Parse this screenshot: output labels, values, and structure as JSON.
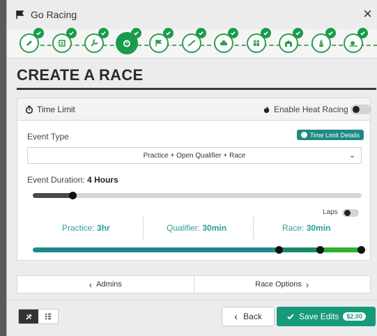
{
  "window": {
    "title": "Go Racing",
    "close_glyph": "×"
  },
  "steps": [
    {
      "icon": "pencil-icon",
      "done": true
    },
    {
      "icon": "list-icon",
      "done": true
    },
    {
      "icon": "wrench-icon",
      "done": true
    },
    {
      "icon": "stopwatch-icon",
      "done": true,
      "active": true
    },
    {
      "icon": "flag-icon",
      "done": true
    },
    {
      "icon": "track-icon",
      "done": true
    },
    {
      "icon": "car-icon",
      "done": true
    },
    {
      "icon": "grid-icon",
      "done": true
    },
    {
      "icon": "garage-icon",
      "done": true
    },
    {
      "icon": "road-icon",
      "done": true
    },
    {
      "icon": "weather-icon",
      "done": true
    }
  ],
  "heading": "CREATE A RACE",
  "card": {
    "section_title": "Time Limit",
    "heat_racing_label": "Enable Heat Racing",
    "event_type_label": "Event Type",
    "time_limit_details": "Time Limit Details",
    "event_type_value": "Practice + Open Qualifier + Race",
    "event_duration_label": "Event Duration:",
    "event_duration_value": "4 Hours",
    "event_duration_fraction": 0.12,
    "laps_label": "Laps",
    "practice_label": "Practice:",
    "practice_value": "3hr",
    "qualifier_label": "Qualifier:",
    "qualifier_value": "30min",
    "race_label": "Race:",
    "race_value": "30min",
    "split_fractions": [
      0.75,
      0.125,
      0.125
    ]
  },
  "nav": {
    "prev_label": "Admins",
    "next_label": "Race Options"
  },
  "footer": {
    "back_label": "Back",
    "save_label": "Save Edits",
    "price": "$2.00"
  },
  "colors": {
    "accent_green": "#1a9a4c",
    "teal": "#1f8a83",
    "practice": "#1a8a8a",
    "qualifier": "#168a6a",
    "race": "#2bb12f",
    "save_button": "#169a7b"
  }
}
